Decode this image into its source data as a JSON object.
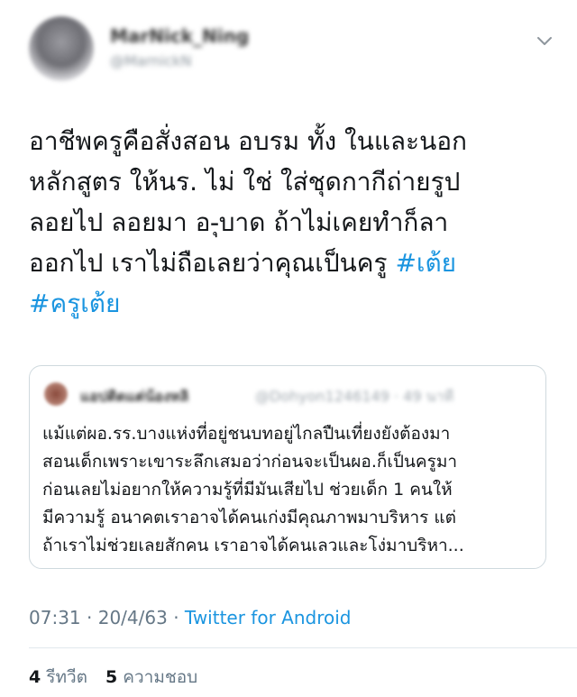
{
  "author": {
    "display_name": "MarNick_Ning",
    "handle": "@MarnickN"
  },
  "tweet": {
    "lines": [
      "อาชีพครูคือสั่งสอน อบรม ทั้ง ในและนอก",
      "หลักสูตร ให้นร. ไม่ ใช่ ใส่ชุดกากีถ่ายรูป",
      "ลอยไป ลอยมา อ-ุบาด ถ้าไม่เคยทำก็ลา",
      "ออกไป เราไม่ถือเลยว่าคุณเป็นครู "
    ],
    "hashtag_1": "#เต้ย",
    "hashtag_2": "#ครูเต้ย"
  },
  "quote": {
    "name": "แอปติดแต่น้องหลิ",
    "handle": "@Dohyon1246149 · 49 นาที",
    "lines": [
      "แม้แต่ผอ.รร.บางแห่งที่อยู่ชนบทอยู่ไกลปืนเที่ยงยังต้องมา",
      "สอนเด็กเพราะเขาระลึกเสมอว่าก่อนจะเป็นผอ.ก็เป็นครูมา",
      "ก่อนเลยไม่อยากให้ความรู้ที่มีมันเสียไป ช่วยเด็ก 1 คนให้",
      "มีความรู้ อนาคตเราอาจได้คนเก่งมีคุณภาพมาบริหาร แต่",
      "ถ้าเราไม่ช่วยเลยสักคน เราอาจได้คนเลวและโง่มาบริหา..."
    ]
  },
  "meta": {
    "time": "07:31",
    "date": "20/4/63",
    "source": "Twitter for Android",
    "separator": "·"
  },
  "stats": {
    "retweets_count": "4",
    "retweets_label": "รีทวีต",
    "likes_count": "5",
    "likes_label": "ความชอบ"
  },
  "icons": {
    "caret": "chevron-down-icon"
  },
  "colors": {
    "link": "#1b95e0",
    "secondary_text": "#657786",
    "border": "#cfd9de"
  }
}
